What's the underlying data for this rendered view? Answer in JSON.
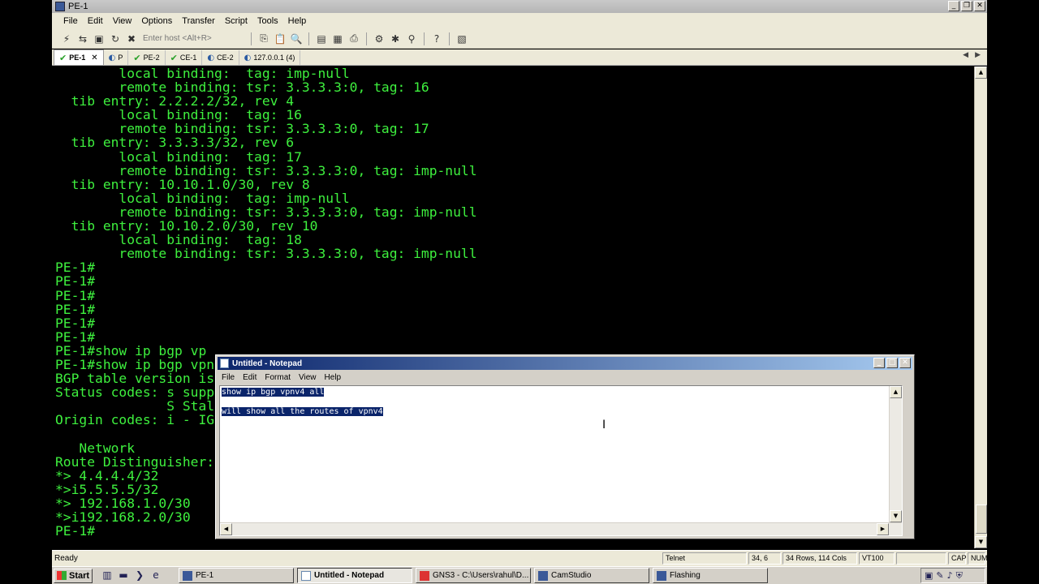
{
  "app": {
    "title": "PE-1",
    "menu": [
      "File",
      "Edit",
      "View",
      "Options",
      "Transfer",
      "Script",
      "Tools",
      "Help"
    ],
    "host_placeholder": "Enter host <Alt+R>",
    "tabs": [
      {
        "label": "PE-1",
        "state": "connected",
        "active": true
      },
      {
        "label": "P",
        "state": "disconnected",
        "active": false
      },
      {
        "label": "PE-2",
        "state": "connected",
        "active": false
      },
      {
        "label": "CE-1",
        "state": "connected",
        "active": false
      },
      {
        "label": "CE-2",
        "state": "disconnected",
        "active": false
      },
      {
        "label": "127.0.0.1 (4)",
        "state": "disconnected",
        "active": false
      }
    ],
    "terminal_text": "        local binding:  tag: imp-null\n        remote binding: tsr: 3.3.3.3:0, tag: 16\n  tib entry: 2.2.2.2/32, rev 4\n        local binding:  tag: 16\n        remote binding: tsr: 3.3.3.3:0, tag: 17\n  tib entry: 3.3.3.3/32, rev 6\n        local binding:  tag: 17\n        remote binding: tsr: 3.3.3.3:0, tag: imp-null\n  tib entry: 10.10.1.0/30, rev 8\n        local binding:  tag: imp-null\n        remote binding: tsr: 3.3.3.3:0, tag: imp-null\n  tib entry: 10.10.2.0/30, rev 10\n        local binding:  tag: 18\n        remote binding: tsr: 3.3.3.3:0, tag: imp-null\nPE-1#\nPE-1#\nPE-1#\nPE-1#\nPE-1#\nPE-1#\nPE-1#show ip bgp vp\nPE-1#show ip bgp vpn\nBGP table version is\nStatus codes: s supp\n              S Stal\nOrigin codes: i - IG\n\n   Network\nRoute Distinguisher:\n*> 4.4.4.4/32\n*>i5.5.5.5/32\n*> 192.168.1.0/30\n*>i192.168.2.0/30\nPE-1#",
    "status": {
      "ready": "Ready",
      "protocol": "Telnet",
      "cursor": "34,  6",
      "size": "34 Rows, 114 Cols",
      "emulation": "VT100",
      "caps": "CAP",
      "num": "NUM"
    }
  },
  "notepad": {
    "title": "Untitled - Notepad",
    "menu": [
      "File",
      "Edit",
      "Format",
      "View",
      "Help"
    ],
    "lines": [
      "show ip bgp vpnv4 all ",
      "",
      "will show all the routes of vpnv4"
    ]
  },
  "taskbar": {
    "start": "Start",
    "tasks": [
      {
        "label": "PE-1",
        "active": false
      },
      {
        "label": "Untitled - Notepad",
        "active": true
      },
      {
        "label": "GNS3 - C:\\Users\\rahul\\D...",
        "active": false
      },
      {
        "label": "CamStudio",
        "active": false
      },
      {
        "label": "Flashing",
        "active": false
      }
    ]
  }
}
